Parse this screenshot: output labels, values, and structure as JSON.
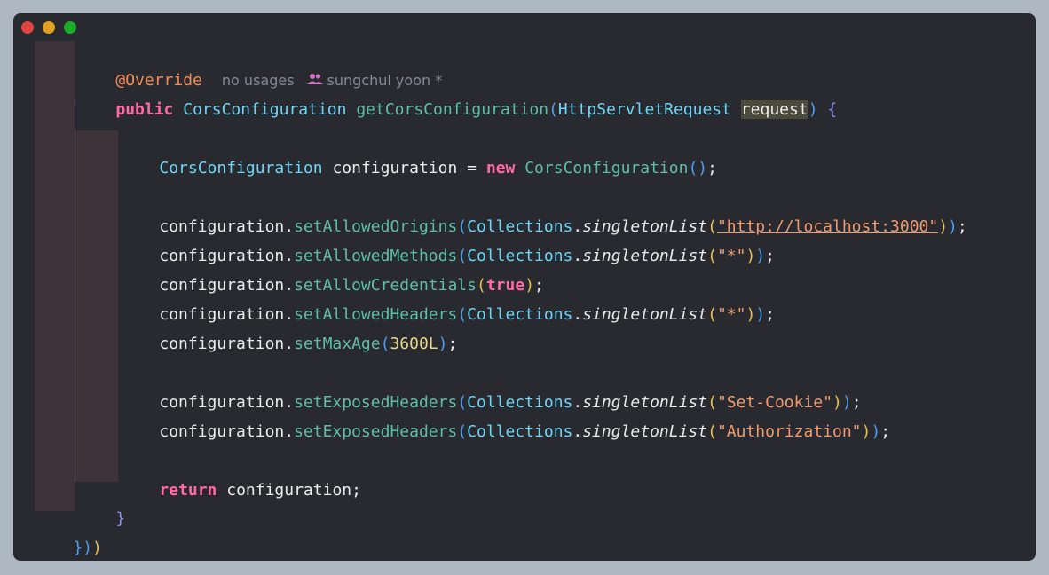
{
  "window": {
    "buttons": {
      "close": "close",
      "minimize": "minimize",
      "maximize": "maximize"
    }
  },
  "code": {
    "annotation": "@Override",
    "usage_hint": "no usages",
    "author": "sungchul yoon *",
    "sig": {
      "public": "public",
      "ret_type": "CorsConfiguration",
      "method": "getCorsConfiguration",
      "open": "(",
      "param_type": "HttpServletRequest",
      "param_name": "request",
      "close": ")",
      "brace": "{"
    },
    "decl": {
      "type": "CorsConfiguration",
      "var": "configuration",
      "eq": "=",
      "new": "new",
      "ctor": "CorsConfiguration",
      "parens": "()",
      "semi": ";"
    },
    "obj": "configuration.",
    "collections": "Collections",
    "dot": ".",
    "singleton": "singletonList",
    "lines": {
      "origins": {
        "method": "setAllowedOrigins",
        "arg": "\"http://localhost:3000\""
      },
      "methods": {
        "method": "setAllowedMethods",
        "arg": "\"*\""
      },
      "creds": {
        "method": "setAllowCredentials",
        "arg": "true"
      },
      "headers": {
        "method": "setAllowedHeaders",
        "arg": "\"*\""
      },
      "maxage": {
        "method": "setMaxAge",
        "arg": "3600L"
      },
      "exposed1": {
        "method": "setExposedHeaders",
        "arg": "\"Set-Cookie\""
      },
      "exposed2": {
        "method": "setExposedHeaders",
        "arg": "\"Authorization\""
      }
    },
    "ret": {
      "kw": "return",
      "val": "configuration;"
    },
    "close_brace": "}",
    "final": {
      "a": "}",
      "b": ")",
      "c": ")"
    }
  }
}
